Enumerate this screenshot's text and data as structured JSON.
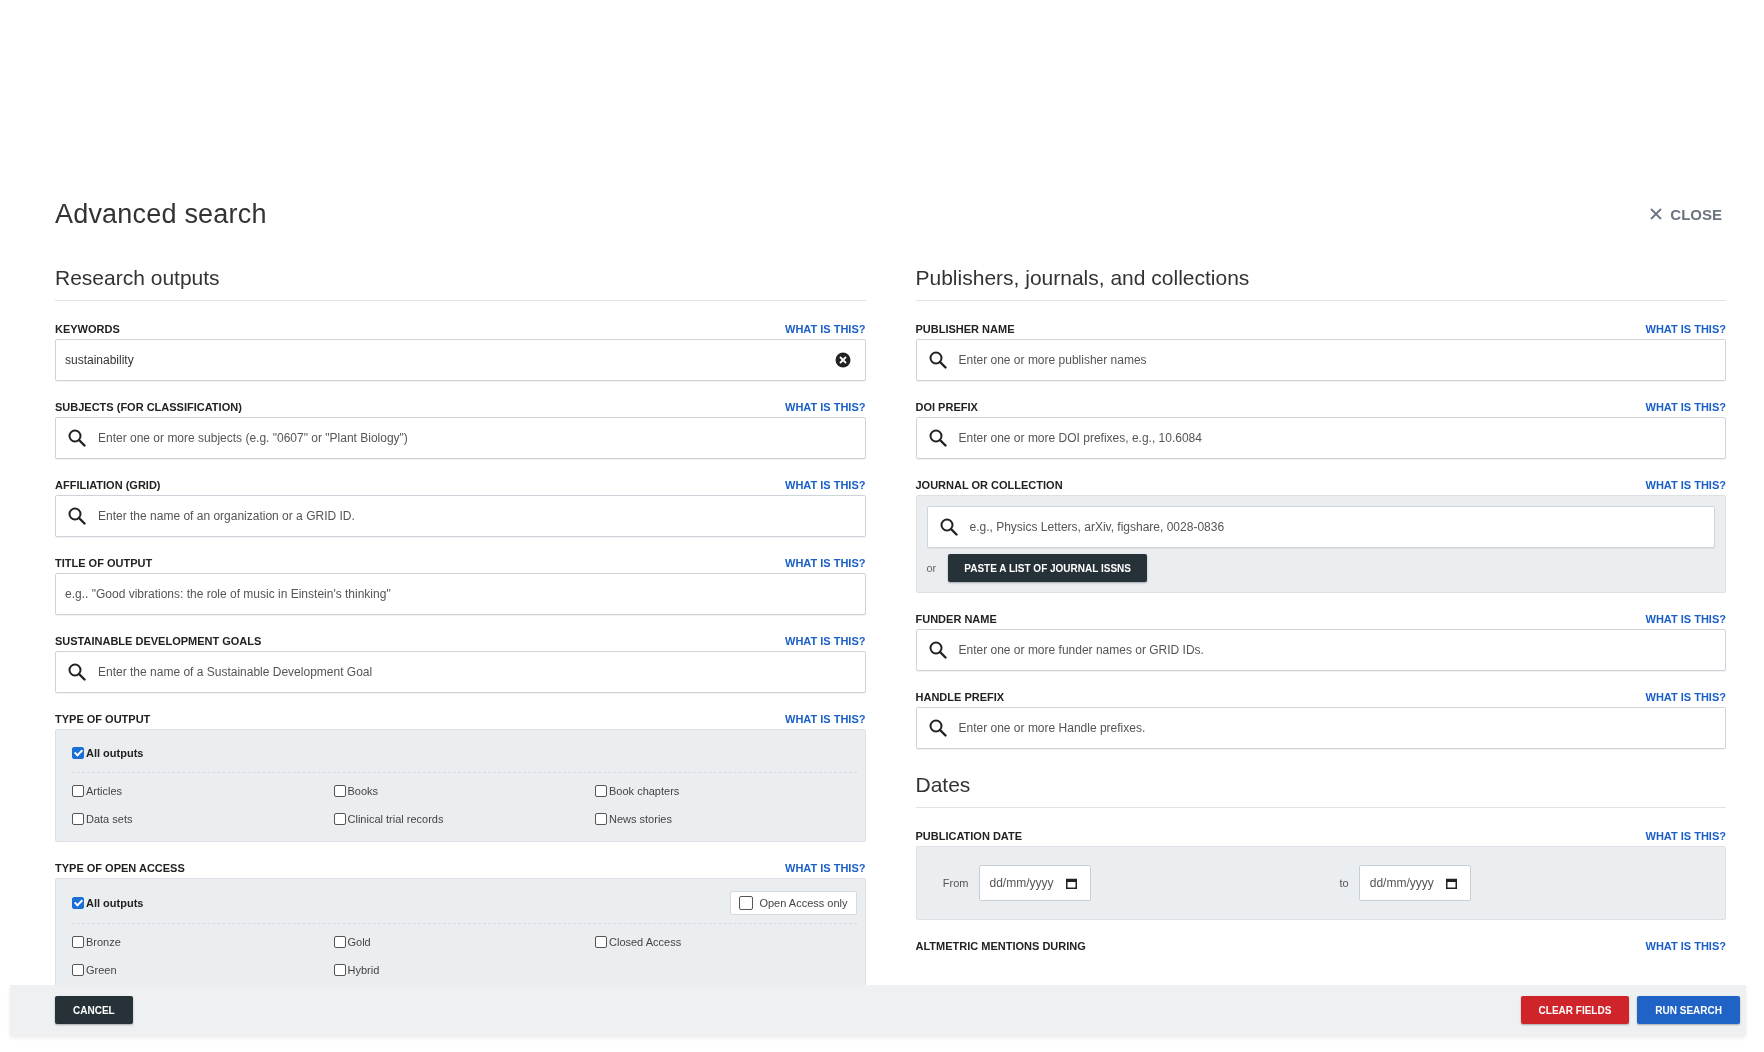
{
  "dialog": {
    "title": "Advanced search",
    "close_label": "CLOSE"
  },
  "columns": [
    {
      "sections": [
        {
          "heading": "Research outputs",
          "fields": [
            {
              "kind": "clearable",
              "label": "KEYWORDS",
              "help": "WHAT IS THIS?",
              "value": "sustainability"
            },
            {
              "kind": "search",
              "label": "SUBJECTS (FOR CLASSIFICATION)",
              "help": "WHAT IS THIS?",
              "placeholder": "Enter one or more subjects (e.g. \"0607\" or \"Plant Biology\")"
            },
            {
              "kind": "search",
              "label": "AFFILIATION (GRID)",
              "help": "WHAT IS THIS?",
              "placeholder": "Enter the name of an organization or a GRID ID."
            },
            {
              "kind": "plain",
              "label": "TITLE OF OUTPUT",
              "help": "WHAT IS THIS?",
              "placeholder": "e.g.. \"Good vibrations: the role of music in Einstein's thinking\""
            },
            {
              "kind": "search",
              "label": "SUSTAINABLE DEVELOPMENT GOALS",
              "help": "WHAT IS THIS?",
              "placeholder": "Enter the name of a Sustainable Development Goal"
            },
            {
              "kind": "checkgroup",
              "label": "TYPE OF OUTPUT",
              "help": "WHAT IS THIS?",
              "all": {
                "label": "All outputs",
                "checked": true
              },
              "options": [
                {
                  "label": "Articles",
                  "checked": false
                },
                {
                  "label": "Books",
                  "checked": false
                },
                {
                  "label": "Book chapters",
                  "checked": false
                },
                {
                  "label": "Data sets",
                  "checked": false
                },
                {
                  "label": "Clinical trial records",
                  "checked": false
                },
                {
                  "label": "News stories",
                  "checked": false
                }
              ]
            },
            {
              "kind": "checkgroup",
              "label": "TYPE OF OPEN ACCESS",
              "help": "WHAT IS THIS?",
              "all": {
                "label": "All outputs",
                "checked": true
              },
              "toggle": {
                "label": "Open Access only",
                "checked": false
              },
              "options": [
                {
                  "label": "Bronze",
                  "checked": false
                },
                {
                  "label": "Gold",
                  "checked": false
                },
                {
                  "label": "Closed Access",
                  "checked": false
                },
                {
                  "label": "Green",
                  "checked": false
                },
                {
                  "label": "Hybrid",
                  "checked": false
                }
              ]
            }
          ]
        }
      ]
    },
    {
      "sections": [
        {
          "heading": "Publishers, journals, and collections",
          "fields": [
            {
              "kind": "search",
              "label": "PUBLISHER NAME",
              "help": "WHAT IS THIS?",
              "placeholder": "Enter one or more publisher names"
            },
            {
              "kind": "search",
              "label": "DOI PREFIX",
              "help": "WHAT IS THIS?",
              "placeholder": "Enter one or more DOI prefixes, e.g., 10.6084"
            },
            {
              "kind": "journal",
              "label": "JOURNAL OR COLLECTION",
              "help": "WHAT IS THIS?",
              "placeholder": "e.g., Physics Letters, arXiv, figshare, 0028-0836",
              "or": "or",
              "button": "PASTE A LIST OF JOURNAL ISSNS"
            },
            {
              "kind": "search",
              "label": "FUNDER NAME",
              "help": "WHAT IS THIS?",
              "placeholder": "Enter one or more funder names or GRID IDs."
            },
            {
              "kind": "search",
              "label": "HANDLE PREFIX",
              "help": "WHAT IS THIS?",
              "placeholder": "Enter one or more Handle prefixes."
            }
          ]
        },
        {
          "heading": "Dates",
          "fields": [
            {
              "kind": "daterange",
              "label": "PUBLICATION DATE",
              "help": "WHAT IS THIS?",
              "from_label": "From",
              "from_placeholder": "dd/mm/yyyy",
              "to_label": "to",
              "to_placeholder": "dd/mm/yyyy"
            },
            {
              "kind": "label_only",
              "label": "ALTMETRIC MENTIONS DURING",
              "help": "WHAT IS THIS?"
            }
          ]
        }
      ]
    }
  ],
  "footer": {
    "buttons": [
      {
        "kind": "cancel",
        "label": "CANCEL"
      },
      {
        "kind": "clear",
        "label": "CLEAR FIELDS"
      },
      {
        "kind": "run",
        "label": "RUN SEARCH"
      }
    ]
  }
}
